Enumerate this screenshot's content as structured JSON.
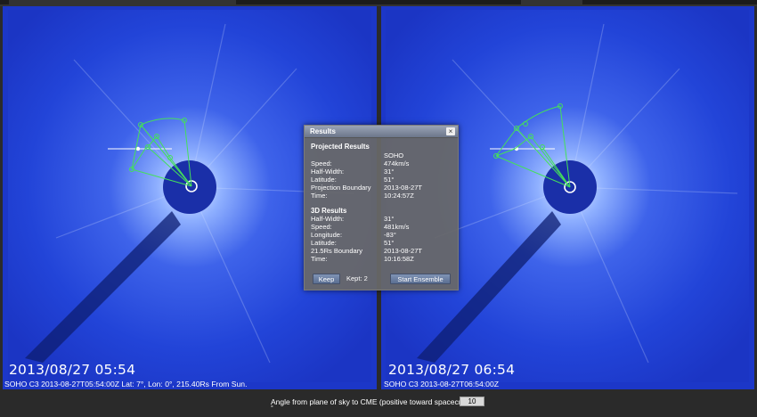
{
  "left_panel": {
    "timestamp": "2013/08/27  05:54",
    "info": "SOHO C3 2013-08-27T05:54:00Z Lat: 7°, Lon: 0°, 215.40Rs From Sun."
  },
  "right_panel": {
    "timestamp": "2013/08/27  06:54",
    "info": "SOHO C3 2013-08-27T06:54:00Z"
  },
  "angle_control": {
    "label": "Angle from plane of sky to CME (positive toward spacecraft):",
    "unit": "°",
    "value": "10"
  },
  "results_dialog": {
    "title": "Results",
    "close_label": "×",
    "projected": {
      "heading": "Projected Results",
      "column": "SOHO",
      "rows": [
        {
          "label": "Speed:",
          "value": "474km/s"
        },
        {
          "label": "Half-Width:",
          "value": "31°"
        },
        {
          "label": "Latitude:",
          "value": "51°"
        },
        {
          "label": "Projection Boundary",
          "value": "2013-08-27T"
        },
        {
          "label": "Time:",
          "value": "10:24:57Z"
        }
      ]
    },
    "three_d": {
      "heading": "3D Results",
      "rows": [
        {
          "label": "Half-Width:",
          "value": "31°"
        },
        {
          "label": "Speed:",
          "value": "481km/s"
        },
        {
          "label": "Longitude:",
          "value": "-83°"
        },
        {
          "label": "Latitude:",
          "value": "51°"
        },
        {
          "label": "21.5Rs Boundary",
          "value": "2013-08-27T"
        },
        {
          "label": "Time:",
          "value": "10:16:58Z"
        }
      ]
    },
    "keep_label": "Keep",
    "kept_label": "Kept: 2",
    "ensemble_label": "Start Ensemble"
  },
  "colors": {
    "coronagraph_blue": "#1f3fd8",
    "occulter": "#1a2fa8",
    "cone_outline": "#44e05a",
    "dialog_bg": "#686868"
  },
  "icons": {
    "close": "close-icon",
    "sun_marker": "sun-circle-icon"
  }
}
